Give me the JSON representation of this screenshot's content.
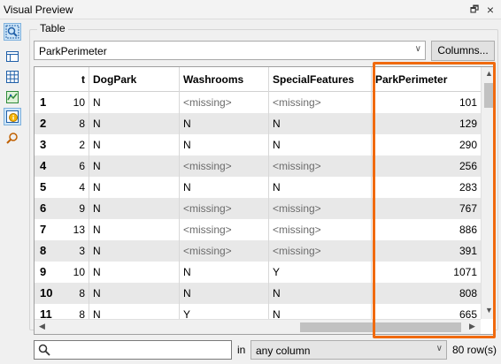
{
  "window": {
    "title": "Visual Preview",
    "float_glyph": "🗗",
    "close_glyph": "×"
  },
  "toolbar": {
    "tools": [
      {
        "name": "zoom-fit-icon",
        "active": true
      },
      {
        "name": "table-view-icon",
        "active": false
      },
      {
        "name": "grid-view-icon",
        "active": false
      },
      {
        "name": "map-view-icon",
        "active": false
      },
      {
        "name": "feature-info-icon",
        "active": true
      },
      {
        "name": "inspect-icon",
        "active": false
      }
    ]
  },
  "panel": {
    "group_label": "Table",
    "table_selector": "ParkPerimeter",
    "columns_button": "Columns..."
  },
  "table": {
    "headers": [
      "t",
      "DogPark",
      "Washrooms",
      "SpecialFeatures",
      "ParkPerimeter"
    ],
    "rows": [
      {
        "idx": "1",
        "t": "10",
        "dog": "N",
        "wash": "<missing>",
        "special": "<missing>",
        "perim": "101"
      },
      {
        "idx": "2",
        "t": "8",
        "dog": "N",
        "wash": "N",
        "special": "N",
        "perim": "129"
      },
      {
        "idx": "3",
        "t": "2",
        "dog": "N",
        "wash": "N",
        "special": "N",
        "perim": "290"
      },
      {
        "idx": "4",
        "t": "6",
        "dog": "N",
        "wash": "<missing>",
        "special": "<missing>",
        "perim": "256"
      },
      {
        "idx": "5",
        "t": "4",
        "dog": "N",
        "wash": "N",
        "special": "N",
        "perim": "283"
      },
      {
        "idx": "6",
        "t": "9",
        "dog": "N",
        "wash": "<missing>",
        "special": "<missing>",
        "perim": "767"
      },
      {
        "idx": "7",
        "t": "13",
        "dog": "N",
        "wash": "<missing>",
        "special": "<missing>",
        "perim": "886"
      },
      {
        "idx": "8",
        "t": "3",
        "dog": "N",
        "wash": "<missing>",
        "special": "<missing>",
        "perim": "391"
      },
      {
        "idx": "9",
        "t": "10",
        "dog": "N",
        "wash": "N",
        "special": "Y",
        "perim": "1071"
      },
      {
        "idx": "10",
        "t": "8",
        "dog": "N",
        "wash": "N",
        "special": "N",
        "perim": "808"
      },
      {
        "idx": "11",
        "t": "8",
        "dog": "N",
        "wash": "Y",
        "special": "N",
        "perim": "665"
      }
    ],
    "highlight_color": "#f06a0f"
  },
  "footer": {
    "search_value": "",
    "in_label": "in",
    "column_filter": "any column",
    "row_count": "80 row(s)"
  }
}
